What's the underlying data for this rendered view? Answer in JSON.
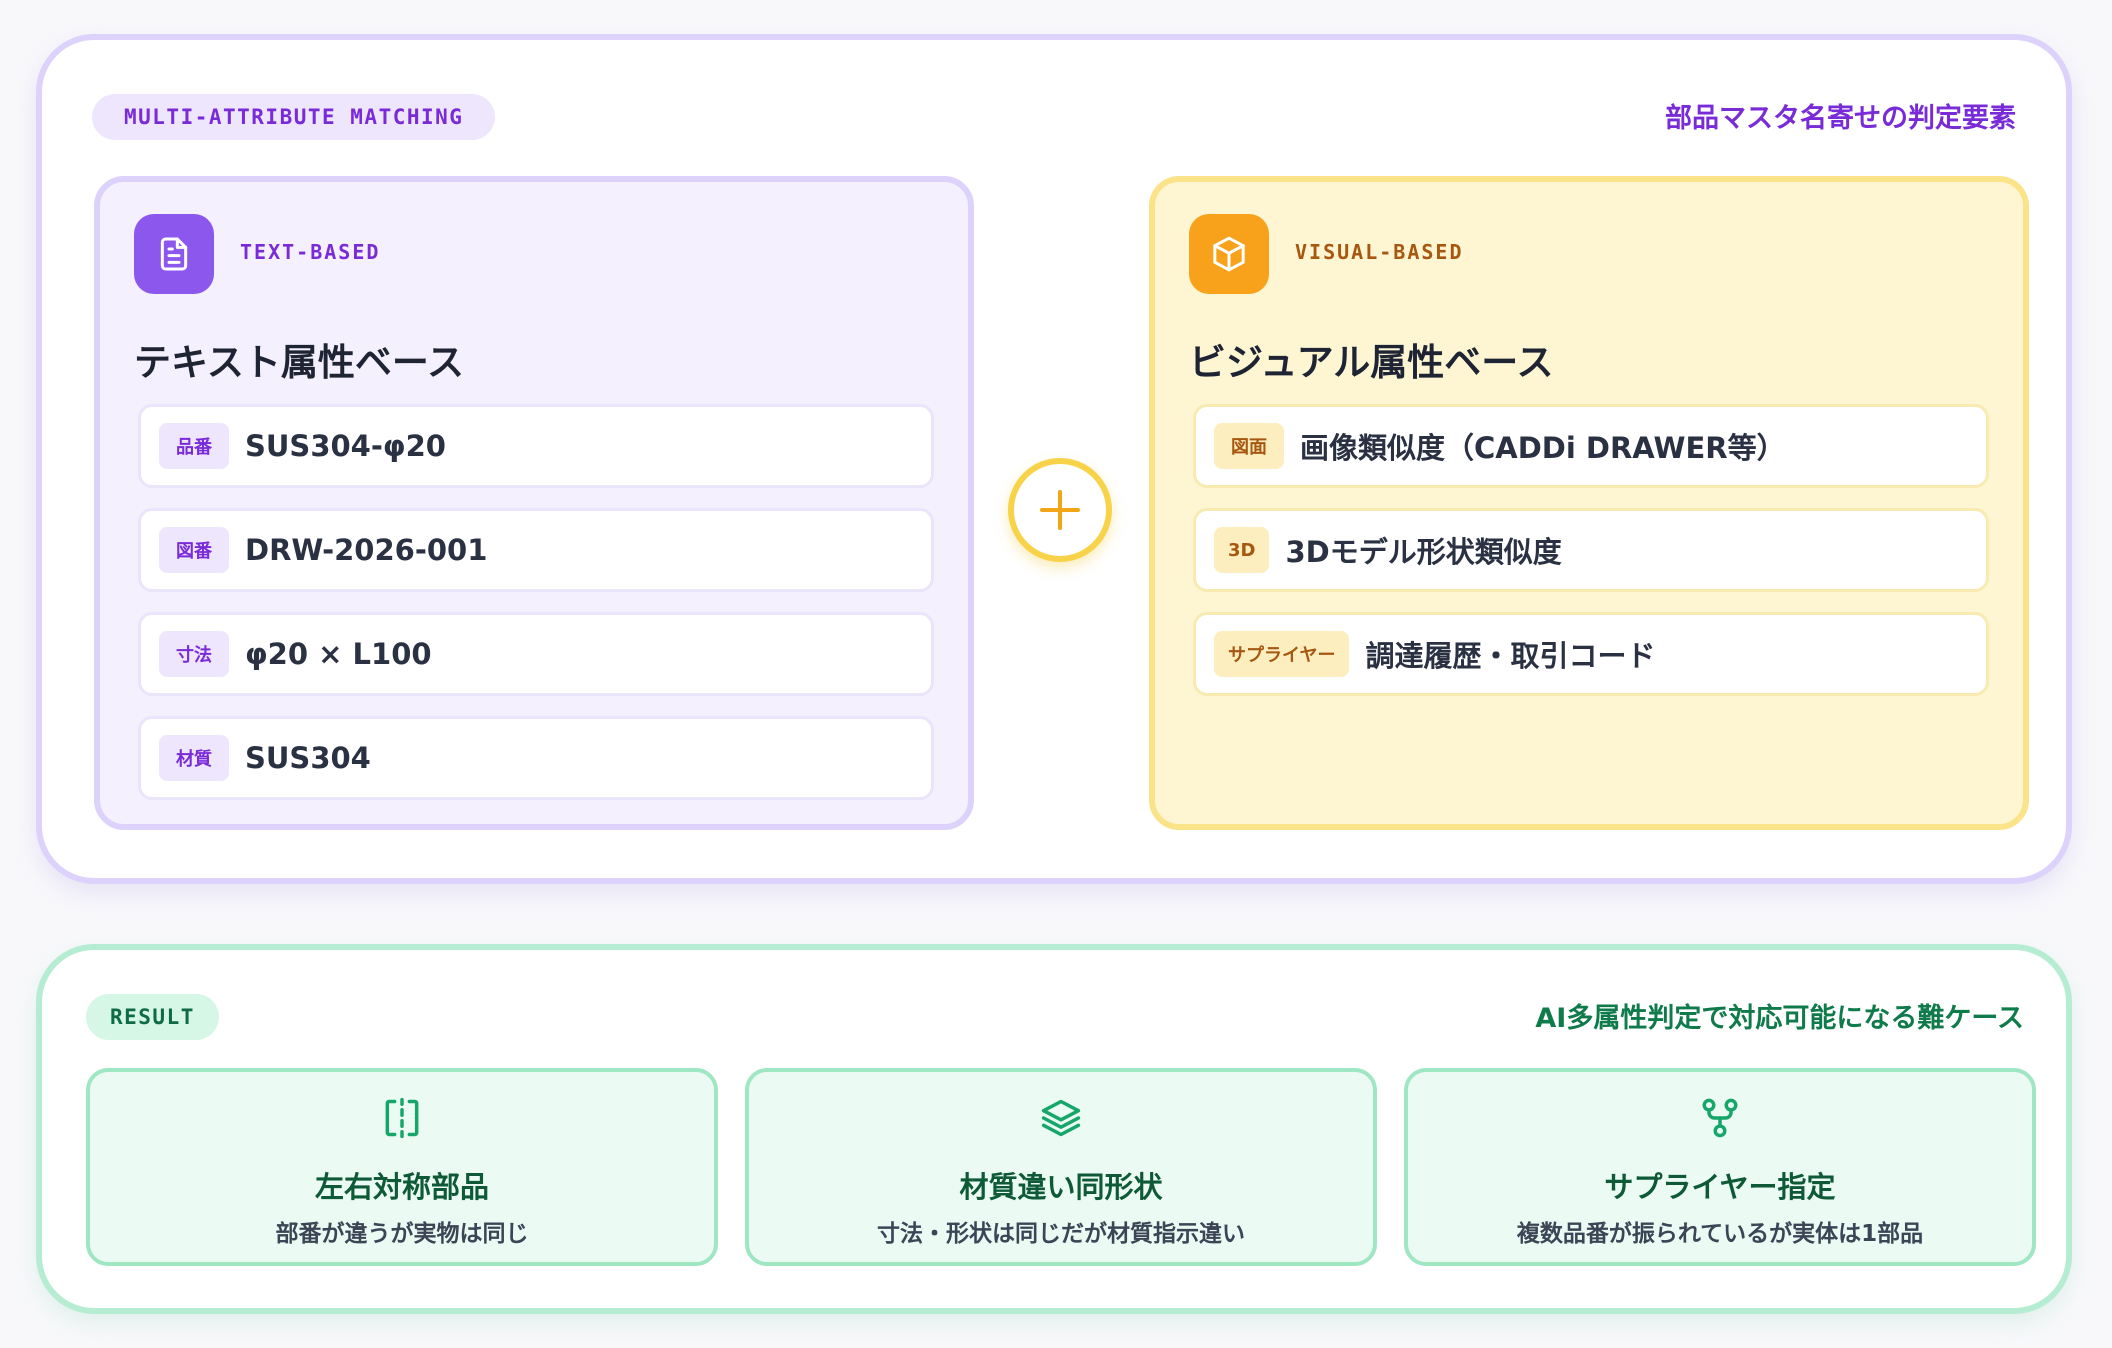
{
  "top": {
    "pill": "MULTI-ATTRIBUTE MATCHING",
    "heading": "部品マスタ名寄せの判定要素",
    "text_card": {
      "kicker": "TEXT-BASED",
      "title": "テキスト属性ベース",
      "icon": "document-icon",
      "rows": [
        {
          "tag": "品番",
          "value": "SUS304-φ20"
        },
        {
          "tag": "図番",
          "value": "DRW-2026-001"
        },
        {
          "tag": "寸法",
          "value": "φ20 × L100"
        },
        {
          "tag": "材質",
          "value": "SUS304"
        }
      ]
    },
    "visual_card": {
      "kicker": "VISUAL-BASED",
      "title": "ビジュアル属性ベース",
      "icon": "cube-icon",
      "rows": [
        {
          "tag": "図面",
          "value": "画像類似度（CADDi DRAWER等）"
        },
        {
          "tag": "3D",
          "value": "3Dモデル形状類似度"
        },
        {
          "tag": "サプライヤー",
          "value": "調達履歴・取引コード"
        }
      ]
    },
    "join_symbol": "+"
  },
  "result": {
    "pill": "RESULT",
    "heading": "AI多属性判定で対応可能になる難ケース",
    "cards": [
      {
        "icon": "symmetry-icon",
        "title": "左右対称部品",
        "sub": "部番が違うが実物は同じ"
      },
      {
        "icon": "layers-icon",
        "title": "材質違い同形状",
        "sub": "寸法・形状は同じだが材質指示違い"
      },
      {
        "icon": "branch-icon",
        "title": "サプライヤー指定",
        "sub": "複数品番が振られているが実体は1部品"
      }
    ]
  },
  "colors": {
    "purple_accent": "#7a2bd8",
    "orange_accent": "#f7a21a",
    "green_accent": "#0f7a4a"
  }
}
